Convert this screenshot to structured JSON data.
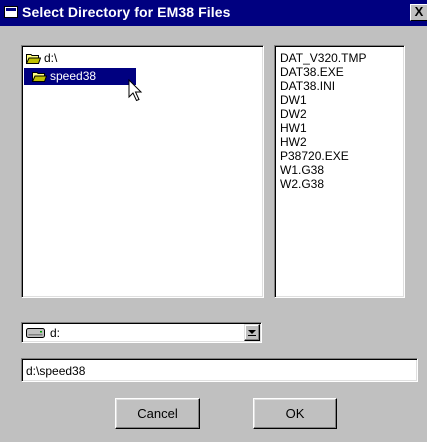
{
  "window": {
    "title": "Select Directory for EM38 Files",
    "close_label": "X"
  },
  "directories": {
    "items": [
      {
        "label": "d:\\",
        "selected": false,
        "icon": "open-folder-icon"
      },
      {
        "label": "speed38",
        "selected": true,
        "icon": "open-folder-icon"
      }
    ]
  },
  "files": {
    "items": [
      "DAT_V320.TMP",
      "DAT38.EXE",
      "DAT38.INI",
      "DW1",
      "DW2",
      "HW1",
      "HW2",
      "P38720.EXE",
      "W1.G38",
      "W2.G38"
    ]
  },
  "drive": {
    "value": "d:",
    "icon": "drive-icon"
  },
  "path": {
    "value": "d:\\speed38"
  },
  "buttons": {
    "cancel": "Cancel",
    "ok": "OK"
  },
  "colors": {
    "titlebar": "#000080",
    "face": "#c0c0c0",
    "selection": "#000080"
  }
}
